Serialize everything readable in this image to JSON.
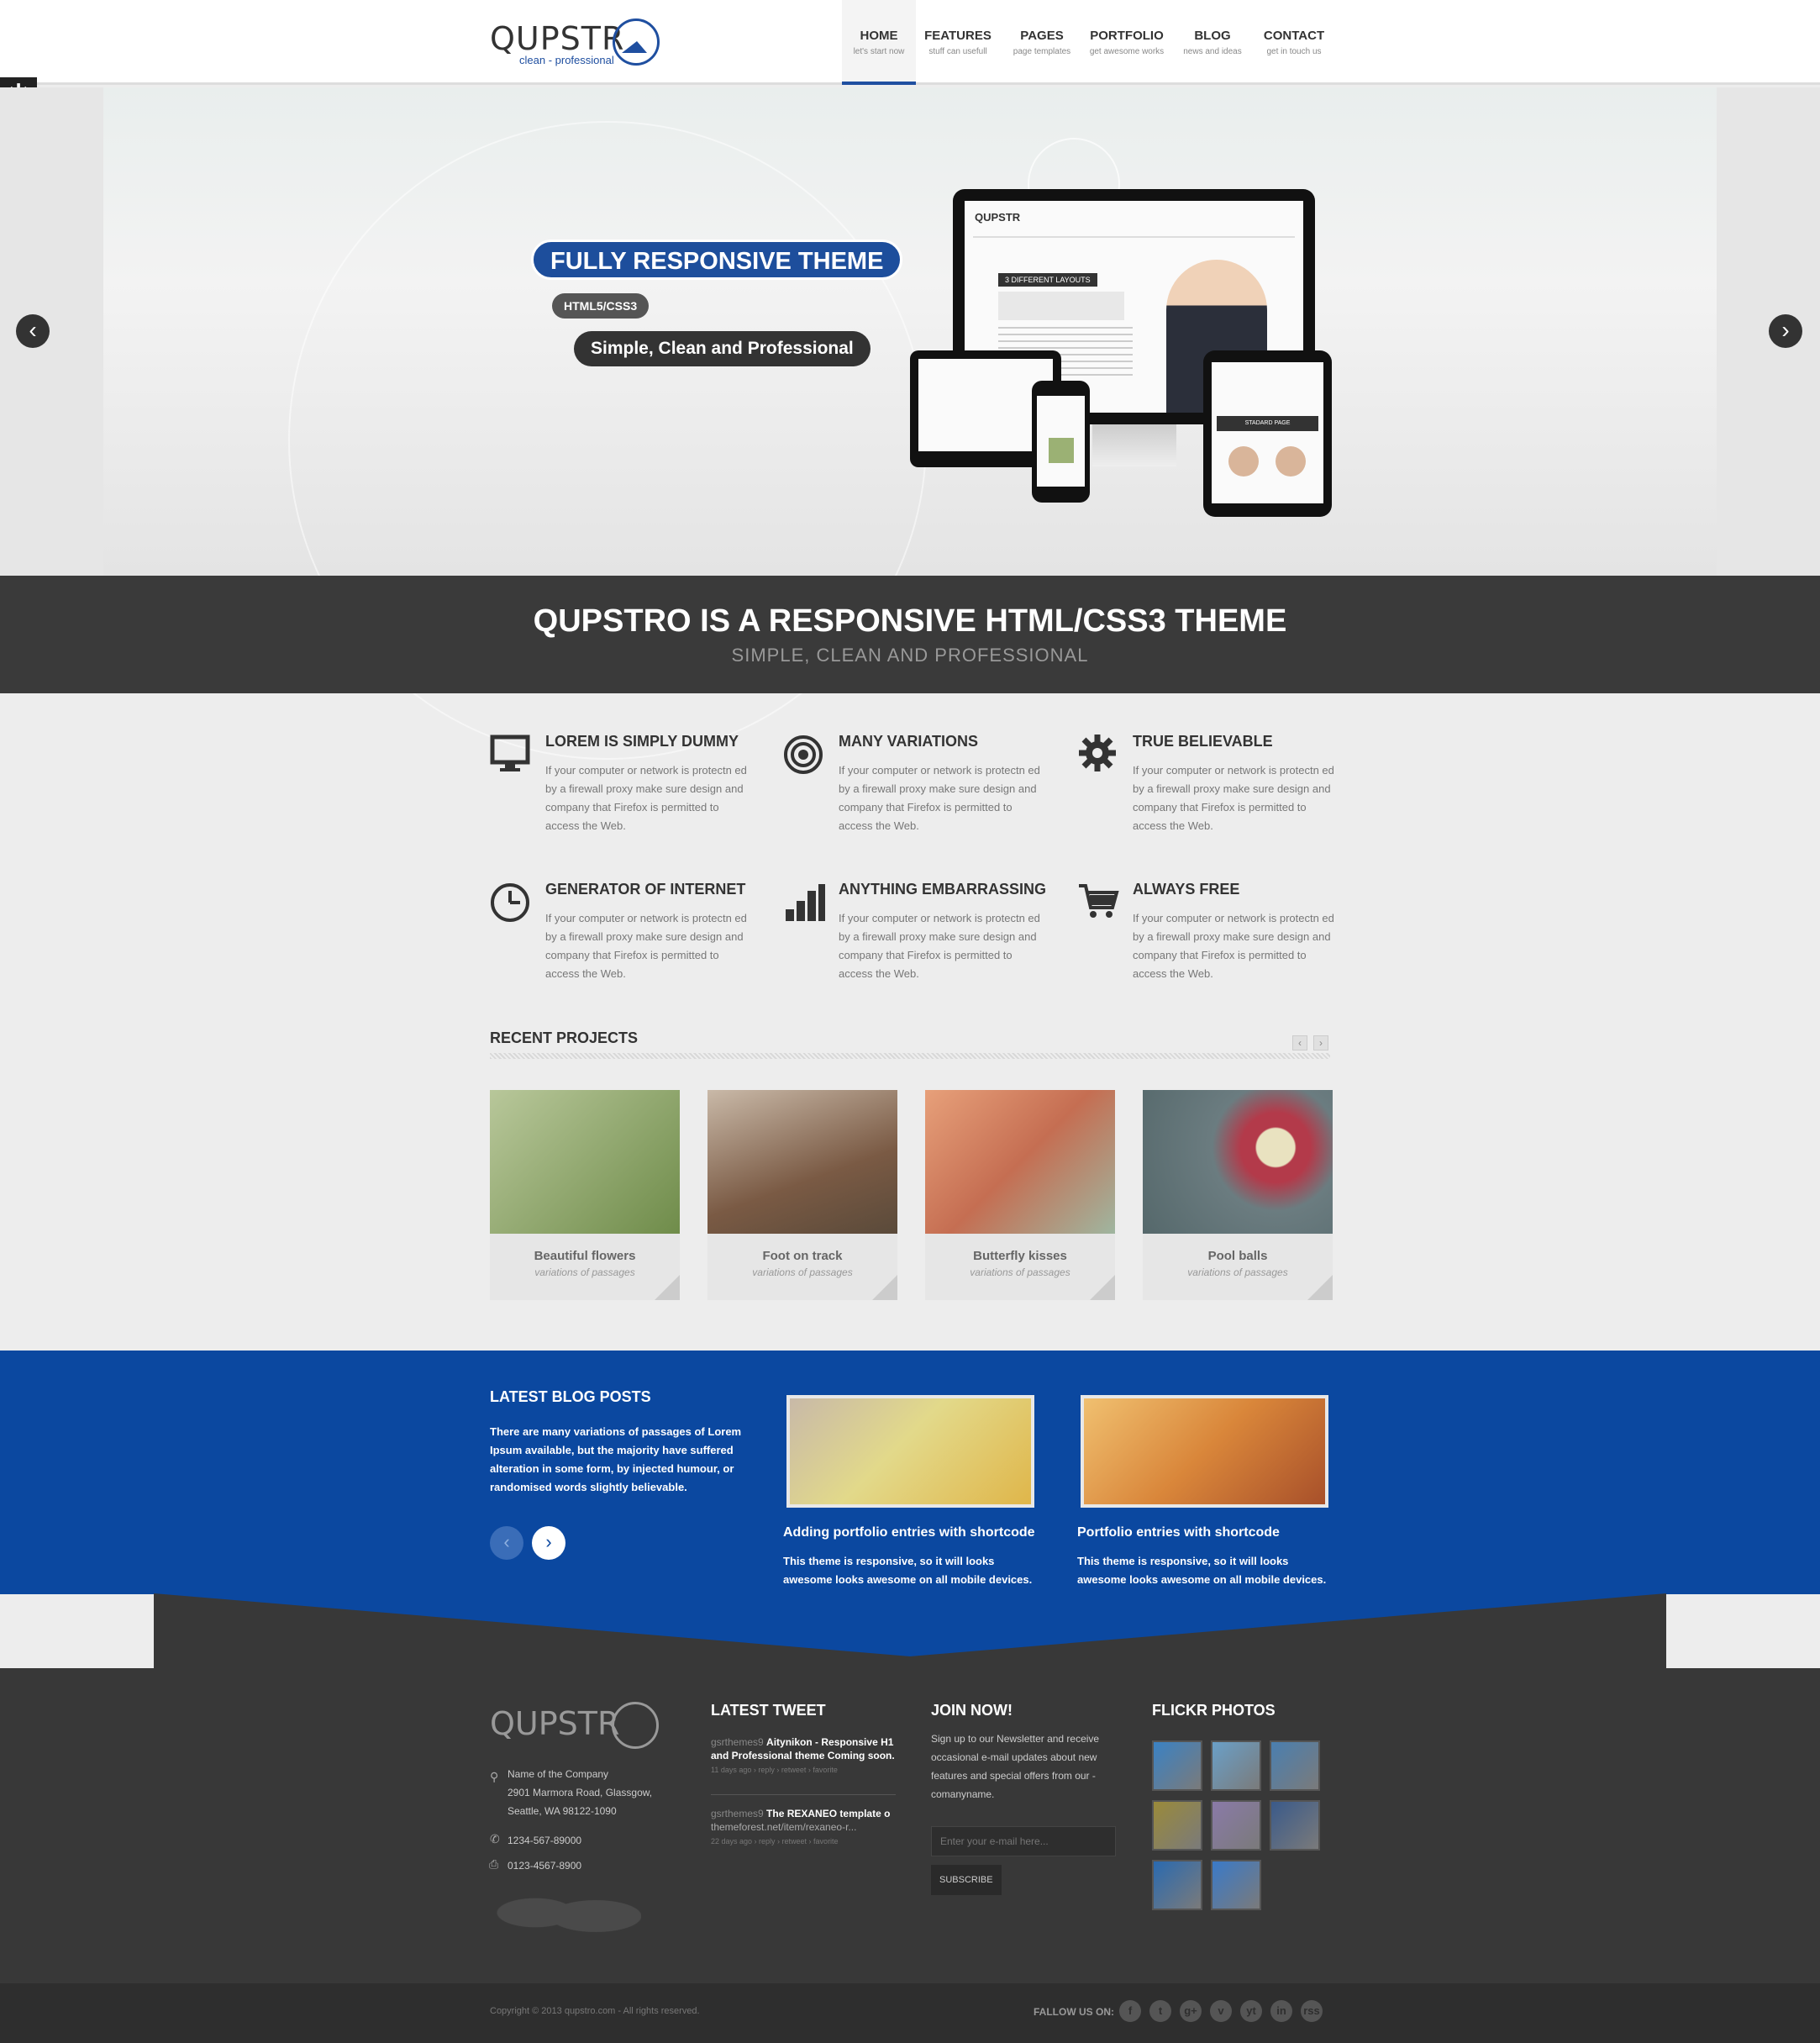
{
  "brand": {
    "logo_text": "QUPSTR",
    "tagline": "clean - professional",
    "accent": "#1f4fa0",
    "blue_band": "#0b48a0",
    "dark": "#383838"
  },
  "nav": {
    "items": [
      {
        "label": "HOME",
        "sub": "let's start now",
        "active": true
      },
      {
        "label": "FEATURES",
        "sub": "stuff can usefull"
      },
      {
        "label": "PAGES",
        "sub": "page templates"
      },
      {
        "label": "PORTFOLIO",
        "sub": "get awesome works"
      },
      {
        "label": "BLOG",
        "sub": "news and ideas"
      },
      {
        "label": "CONTACT",
        "sub": "get in touch us"
      }
    ]
  },
  "settings_icon": "gear-icon",
  "slider": {
    "headline": "FULLY RESPONSIVE THEME",
    "tag": "HTML5/CSS3",
    "subline": "Simple, Clean and Professional",
    "prev_icon": "chevron-left-icon",
    "next_icon": "chevron-right-icon",
    "device_screen_caption": "3 DIFFERENT LAYOUTS",
    "device_page_label": "STADARD PAGE"
  },
  "intro": {
    "title": "QUPSTRO IS A RESPONSIVE HTML/CSS3 THEME",
    "subtitle": "SIMPLE, CLEAN AND PROFESSIONAL"
  },
  "features": [
    {
      "title": "LOREM IS SIMPLY DUMMY",
      "icon": "monitor-icon",
      "text": "If your computer or network is protectn ed by a firewall proxy make sure design and company that Firefox is permitted to access the Web."
    },
    {
      "title": "MANY VARIATIONS",
      "icon": "target-icon",
      "text": "If your computer or network is protectn ed by a firewall proxy make sure design and company that Firefox is permitted to access the Web."
    },
    {
      "title": "TRUE BELIEVABLE",
      "icon": "gear-icon",
      "text": "If your computer or network is protectn ed by a firewall proxy make sure design and company that Firefox is permitted to access the Web."
    },
    {
      "title": "GENERATOR OF INTERNET",
      "icon": "clock-icon",
      "text": "If your computer or network is protectn ed by a firewall proxy make sure design and company that Firefox is permitted to access the Web."
    },
    {
      "title": "ANYTHING EMBARRASSING",
      "icon": "bar-chart-icon",
      "text": "If your computer or network is protectn ed by a firewall proxy make sure design and company that Firefox is permitted to access the Web."
    },
    {
      "title": "ALWAYS FREE",
      "icon": "cart-icon",
      "text": "If your computer or network is protectn ed by a firewall proxy make sure design and company that Firefox is permitted to access the Web."
    }
  ],
  "recent": {
    "title": "RECENT PROJECTS",
    "prev": "‹",
    "next": "›",
    "projects": [
      {
        "title": "Beautiful flowers",
        "sub": "variations of passages",
        "color": "#8fa56a"
      },
      {
        "title": "Foot on track",
        "sub": "variations of passages",
        "color": "#8a6a52"
      },
      {
        "title": "Butterfly kisses",
        "sub": "variations of passages",
        "color": "#d49170"
      },
      {
        "title": "Pool balls",
        "sub": "variations of passages",
        "color": "#7b8c8f"
      }
    ]
  },
  "blog": {
    "title": "LATEST BLOG POSTS",
    "text": "There are many variations of passages of Lorem Ipsum available, but the majority have suffered alteration in some form, by injected humour, or randomised words slightly believable.",
    "posts": [
      {
        "title": "Adding portfolio entries with shortcode",
        "text": "This theme is responsive, so it will looks awesome looks awesome on all mobile devices.",
        "color": "#c9c65a"
      },
      {
        "title": "Portfolio entries with shortcode",
        "text": "This theme is responsive, so it will looks awesome looks awesome on all mobile devices.",
        "color": "#d98a3a"
      }
    ]
  },
  "footer": {
    "logo_text": "QUPSTR",
    "address_name": "Name of the Company",
    "address_line1": "2901 Marmora Road, Glassgow,",
    "address_line2": "Seattle, WA 98122-1090",
    "phone": "1234-567-89000",
    "fax": "0123-4567-8900",
    "tweet_title": "LATEST TWEET",
    "tweets": [
      {
        "user": "gsrthemes9",
        "line1": "Aitynikon - Responsive H1",
        "line2": "and Professional theme Coming soon.",
        "meta": "11 days ago › reply › retweet › favorite"
      },
      {
        "user": "gsrthemes9",
        "line1": "The REXANEO template o",
        "line2": "themeforest.net/item/rexaneo-r...",
        "meta": "22 days ago › reply › retweet › favorite"
      }
    ],
    "join_title": "JOIN NOW!",
    "join_text": "Sign up to our Newsletter and receive occasional e-mail updates about new features and special offers from our - comanyname.",
    "email_placeholder": "Enter your e-mail here...",
    "subscribe": "SUBSCRIBE",
    "flickr_title": "FLICKR PHOTOS",
    "flickr_colors": [
      "#3a82c4",
      "#6aa0c8",
      "#4a7fb0",
      "#9a8a3a",
      "#8a7aa8",
      "#3a5a8a",
      "#2a6ab0",
      "#3a7ac8"
    ],
    "copyright": "Copyright © 2013 qupstro.com - All rights reserved.",
    "follow": "FALLOW US ON:",
    "socials": [
      "f",
      "t",
      "g+",
      "v",
      "yt",
      "in",
      "rss"
    ]
  }
}
